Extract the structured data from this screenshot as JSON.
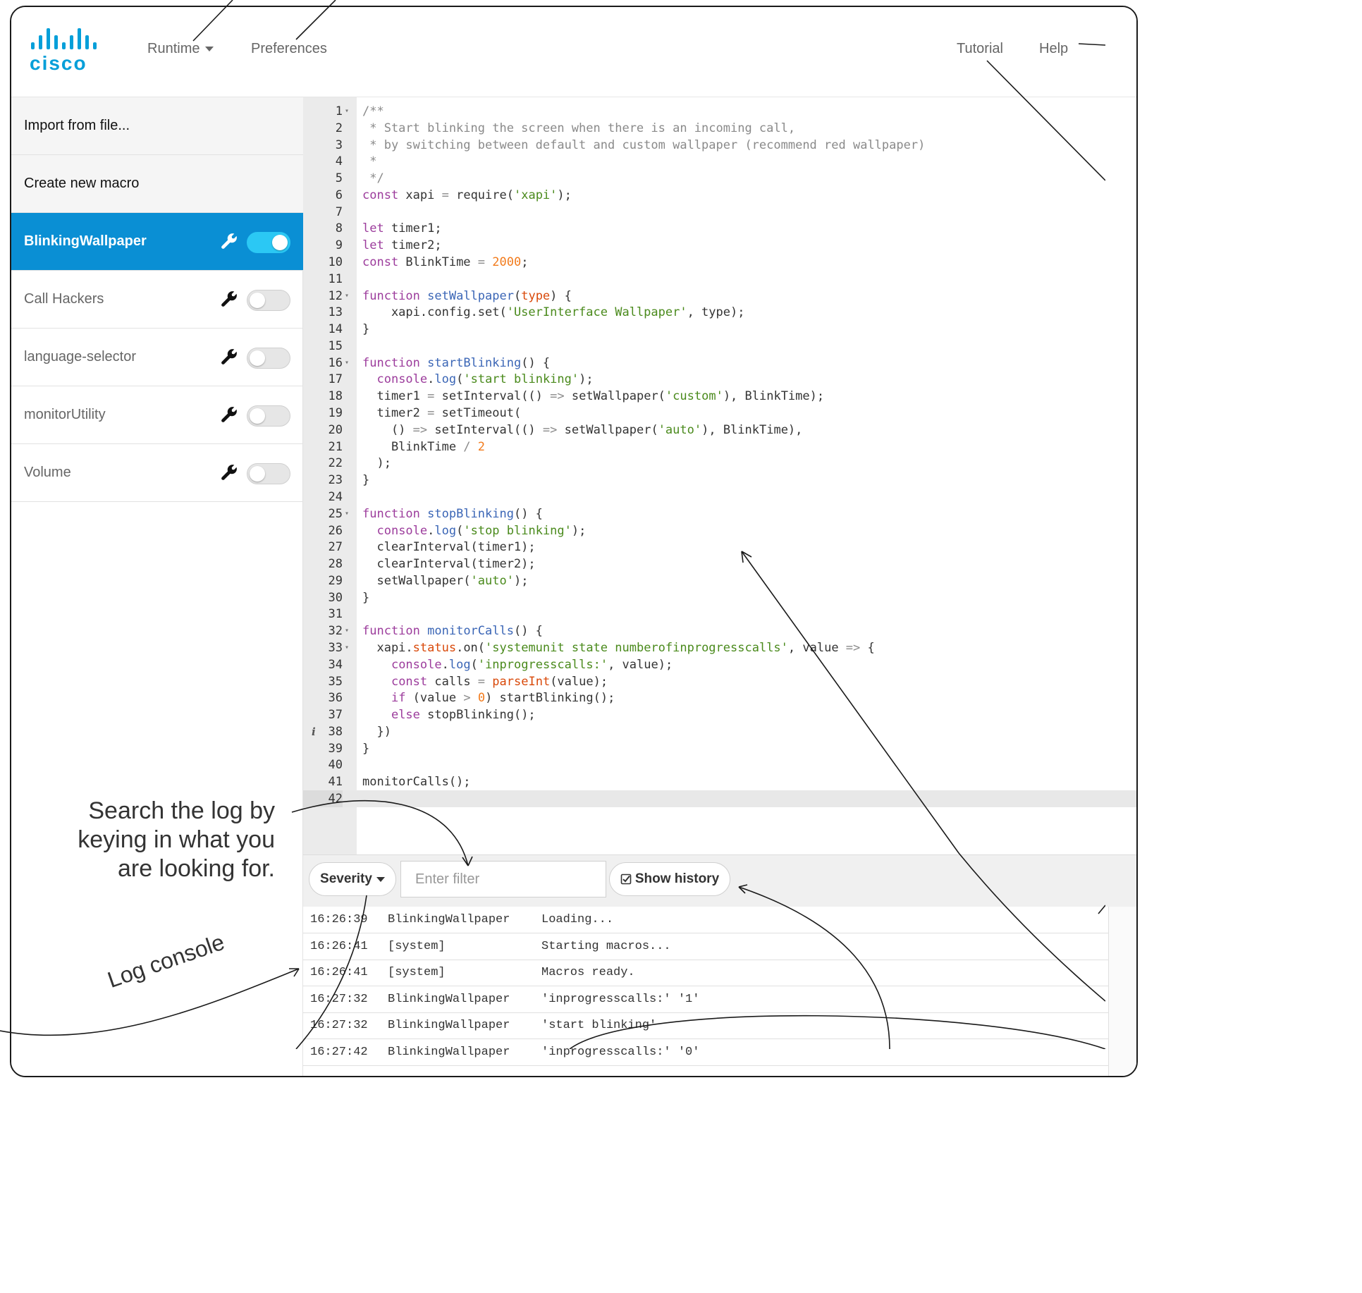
{
  "brand": {
    "logo_text": "cisco",
    "brand_color": "#049fd9"
  },
  "nav": {
    "runtime": "Runtime",
    "preferences": "Preferences",
    "tutorial": "Tutorial",
    "help": "Help"
  },
  "sidebar": {
    "import": "Import from file...",
    "create": "Create new macro",
    "macros": [
      {
        "name": "BlinkingWallpaper",
        "enabled": true,
        "active": true
      },
      {
        "name": "Call Hackers",
        "enabled": false,
        "active": false
      },
      {
        "name": "language-selector",
        "enabled": false,
        "active": false
      },
      {
        "name": "monitorUtility",
        "enabled": false,
        "active": false
      },
      {
        "name": "Volume",
        "enabled": false,
        "active": false
      }
    ],
    "active_color": "#0a8fd4",
    "toggle_on_color": "#2bc8f4"
  },
  "editor": {
    "current_line": 42,
    "info_line": 38,
    "fold_lines": [
      1,
      12,
      16,
      25,
      32,
      33
    ],
    "lines": [
      [
        [
          "cm",
          "/**"
        ]
      ],
      [
        [
          "cm",
          " * Start blinking the screen when there is an incoming call,"
        ]
      ],
      [
        [
          "cm",
          " * by switching between default and custom wallpaper (recommend red wallpaper)"
        ]
      ],
      [
        [
          "cm",
          " *"
        ]
      ],
      [
        [
          "cm",
          " */"
        ]
      ],
      [
        [
          "kw",
          "const"
        ],
        [
          "",
          " xapi "
        ],
        [
          "op",
          "="
        ],
        [
          "",
          " require("
        ],
        [
          "st",
          "'xapi'"
        ],
        [
          "",
          ");"
        ]
      ],
      [],
      [
        [
          "kw",
          "let"
        ],
        [
          "",
          " timer1;"
        ]
      ],
      [
        [
          "kw",
          "let"
        ],
        [
          "",
          " timer2;"
        ]
      ],
      [
        [
          "kw",
          "const"
        ],
        [
          "",
          " BlinkTime "
        ],
        [
          "op",
          "="
        ],
        [
          "",
          " "
        ],
        [
          "nu",
          "2000"
        ],
        [
          "",
          ";"
        ]
      ],
      [],
      [
        [
          "kw",
          "function"
        ],
        [
          "",
          " "
        ],
        [
          "fn",
          "setWallpaper"
        ],
        [
          "",
          "("
        ],
        [
          "pr",
          "type"
        ],
        [
          "",
          ") {"
        ]
      ],
      [
        [
          "",
          "    xapi.config.set("
        ],
        [
          "st",
          "'UserInterface Wallpaper'"
        ],
        [
          "",
          ", type);"
        ]
      ],
      [
        [
          "",
          "}"
        ]
      ],
      [],
      [
        [
          "kw",
          "function"
        ],
        [
          "",
          " "
        ],
        [
          "fn",
          "startBlinking"
        ],
        [
          "",
          "() {"
        ]
      ],
      [
        [
          "",
          "  "
        ],
        [
          "bi",
          "console"
        ],
        [
          "",
          "."
        ],
        [
          "fn",
          "log"
        ],
        [
          "",
          "("
        ],
        [
          "st",
          "'start blinking'"
        ],
        [
          "",
          ");"
        ]
      ],
      [
        [
          "",
          "  timer1 "
        ],
        [
          "op",
          "="
        ],
        [
          "",
          " setInterval(() "
        ],
        [
          "op",
          "=>"
        ],
        [
          "",
          " setWallpaper("
        ],
        [
          "st",
          "'custom'"
        ],
        [
          "",
          "), BlinkTime);"
        ]
      ],
      [
        [
          "",
          "  timer2 "
        ],
        [
          "op",
          "="
        ],
        [
          "",
          " setTimeout("
        ]
      ],
      [
        [
          "",
          "    () "
        ],
        [
          "op",
          "=>"
        ],
        [
          "",
          " setInterval(() "
        ],
        [
          "op",
          "=>"
        ],
        [
          "",
          " setWallpaper("
        ],
        [
          "st",
          "'auto'"
        ],
        [
          "",
          "), BlinkTime),"
        ]
      ],
      [
        [
          "",
          "    BlinkTime "
        ],
        [
          "op",
          "/"
        ],
        [
          "",
          " "
        ],
        [
          "nu",
          "2"
        ]
      ],
      [
        [
          "",
          "  );"
        ]
      ],
      [
        [
          "",
          "}"
        ]
      ],
      [],
      [
        [
          "kw",
          "function"
        ],
        [
          "",
          " "
        ],
        [
          "fn",
          "stopBlinking"
        ],
        [
          "",
          "() {"
        ]
      ],
      [
        [
          "",
          "  "
        ],
        [
          "bi",
          "console"
        ],
        [
          "",
          "."
        ],
        [
          "fn",
          "log"
        ],
        [
          "",
          "("
        ],
        [
          "st",
          "'stop blinking'"
        ],
        [
          "",
          ");"
        ]
      ],
      [
        [
          "",
          "  clearInterval(timer1);"
        ]
      ],
      [
        [
          "",
          "  clearInterval(timer2);"
        ]
      ],
      [
        [
          "",
          "  setWallpaper("
        ],
        [
          "st",
          "'auto'"
        ],
        [
          "",
          ");"
        ]
      ],
      [
        [
          "",
          "}"
        ]
      ],
      [],
      [
        [
          "kw",
          "function"
        ],
        [
          "",
          " "
        ],
        [
          "fn",
          "monitorCalls"
        ],
        [
          "",
          "() {"
        ]
      ],
      [
        [
          "",
          "  xapi."
        ],
        [
          "pr",
          "status"
        ],
        [
          "",
          ".on("
        ],
        [
          "st",
          "'systemunit state numberofinprogresscalls'"
        ],
        [
          "",
          ", value "
        ],
        [
          "op",
          "=>"
        ],
        [
          "",
          " {"
        ]
      ],
      [
        [
          "",
          "    "
        ],
        [
          "bi",
          "console"
        ],
        [
          "",
          "."
        ],
        [
          "fn",
          "log"
        ],
        [
          "",
          "("
        ],
        [
          "st",
          "'inprogresscalls:'"
        ],
        [
          "",
          ", value);"
        ]
      ],
      [
        [
          "",
          "    "
        ],
        [
          "kw",
          "const"
        ],
        [
          "",
          " calls "
        ],
        [
          "op",
          "="
        ],
        [
          "",
          " "
        ],
        [
          "pr",
          "parseInt"
        ],
        [
          "",
          "(value);"
        ]
      ],
      [
        [
          "",
          "    "
        ],
        [
          "kw",
          "if"
        ],
        [
          "",
          " (value "
        ],
        [
          "op",
          ">"
        ],
        [
          "",
          " "
        ],
        [
          "nu",
          "0"
        ],
        [
          "",
          ") startBlinking();"
        ]
      ],
      [
        [
          "",
          "    "
        ],
        [
          "kw",
          "else"
        ],
        [
          "",
          " stopBlinking();"
        ]
      ],
      [
        [
          "",
          "  })"
        ]
      ],
      [
        [
          "",
          "}"
        ]
      ],
      [],
      [
        [
          "",
          "monitorCalls();"
        ]
      ],
      []
    ]
  },
  "logbar": {
    "severity": "Severity",
    "filter_placeholder": "Enter filter",
    "show_history": "Show history"
  },
  "log": [
    {
      "time": "16:26:39",
      "source": "BlinkingWallpaper",
      "message": "Loading..."
    },
    {
      "time": "16:26:41",
      "source": "[system]",
      "message": "Starting macros..."
    },
    {
      "time": "16:26:41",
      "source": "[system]",
      "message": "Macros ready."
    },
    {
      "time": "16:27:32",
      "source": "BlinkingWallpaper",
      "message": "'inprogresscalls:' '1'"
    },
    {
      "time": "16:27:32",
      "source": "BlinkingWallpaper",
      "message": "'start blinking'"
    },
    {
      "time": "16:27:42",
      "source": "BlinkingWallpaper",
      "message": "'inprogresscalls:' '0'"
    }
  ],
  "annotations": {
    "search_hint": "Search the log by keying in what you are looking for.",
    "log_console": "Log console"
  }
}
